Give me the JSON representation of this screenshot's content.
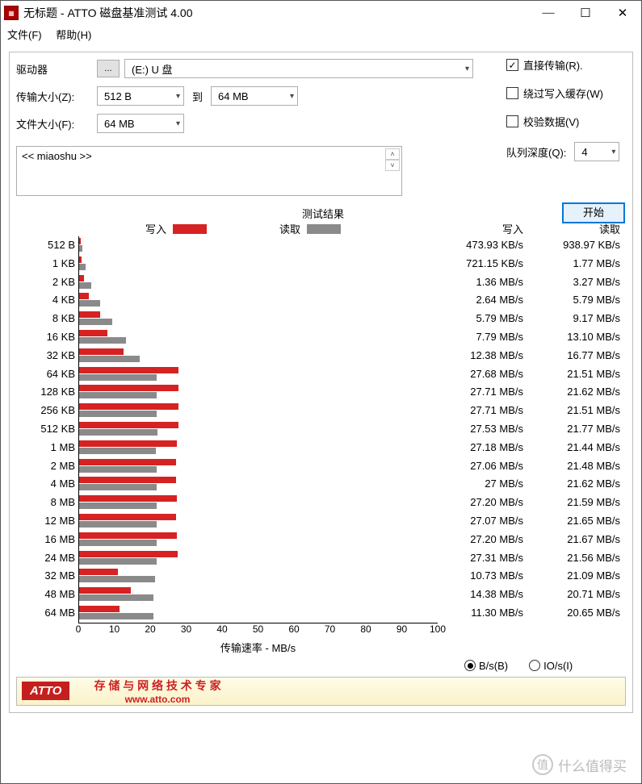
{
  "window": {
    "title": "无标题 - ATTO 磁盘基准测试 4.00"
  },
  "menu": {
    "file": "文件(F)",
    "help": "帮助(H)"
  },
  "labels": {
    "drive": "驱动器",
    "ellipsis": "...",
    "transfer_size": "传输大小(Z):",
    "to": "到",
    "file_size": "文件大小(F):"
  },
  "fields": {
    "drive": "(E:) U 盘",
    "ts_from": "512 B",
    "ts_to": "64 MB",
    "file_size": "64 MB",
    "desc": "<< miaoshu >>",
    "queue_depth": "4"
  },
  "checks": {
    "direct": "直接传输(R).",
    "direct_on": "✓",
    "bypass": "绕过写入缓存(W)",
    "verify": "校验数据(V)",
    "qd_label": "队列深度(Q):"
  },
  "buttons": {
    "start": "开始"
  },
  "results_title": "测试结果",
  "legend": {
    "write": "写入",
    "read": "读取"
  },
  "colors": {
    "write": "#d62222",
    "read": "#8a8a8a"
  },
  "x_axis_label": "传输速率 - MB/s",
  "radio": {
    "bs": "B/s(B)",
    "ios": "IO/s(I)"
  },
  "footer": {
    "brand": "ATTO",
    "slogan": "存 储 与 网 络 技 术 专 家",
    "url": "www.atto.com"
  },
  "watermark": {
    "icon": "值",
    "text": "什么值得买"
  },
  "chart_data": {
    "type": "bar",
    "title": "测试结果",
    "xlabel": "传输速率 - MB/s",
    "xlim": [
      0,
      100
    ],
    "x_ticks": [
      0,
      10,
      20,
      30,
      40,
      50,
      60,
      70,
      80,
      90,
      100
    ],
    "categories": [
      "512 B",
      "1 KB",
      "2 KB",
      "4 KB",
      "8 KB",
      "16 KB",
      "32 KB",
      "64 KB",
      "128 KB",
      "256 KB",
      "512 KB",
      "1 MB",
      "2 MB",
      "4 MB",
      "8 MB",
      "12 MB",
      "16 MB",
      "24 MB",
      "32 MB",
      "48 MB",
      "64 MB"
    ],
    "series": [
      {
        "name": "写入",
        "color": "#d62222",
        "values": [
          0.474,
          0.721,
          1.36,
          2.64,
          5.79,
          7.79,
          12.38,
          27.68,
          27.71,
          27.71,
          27.53,
          27.18,
          27.06,
          27.0,
          27.2,
          27.07,
          27.2,
          27.31,
          10.73,
          14.38,
          11.3
        ],
        "display": [
          "473.93 KB/s",
          "721.15 KB/s",
          "1.36 MB/s",
          "2.64 MB/s",
          "5.79 MB/s",
          "7.79 MB/s",
          "12.38 MB/s",
          "27.68 MB/s",
          "27.71 MB/s",
          "27.71 MB/s",
          "27.53 MB/s",
          "27.18 MB/s",
          "27.06 MB/s",
          "27 MB/s",
          "27.20 MB/s",
          "27.07 MB/s",
          "27.20 MB/s",
          "27.31 MB/s",
          "10.73 MB/s",
          "14.38 MB/s",
          "11.30 MB/s"
        ]
      },
      {
        "name": "读取",
        "color": "#8a8a8a",
        "values": [
          0.939,
          1.77,
          3.27,
          5.79,
          9.17,
          13.1,
          16.77,
          21.51,
          21.62,
          21.51,
          21.77,
          21.44,
          21.48,
          21.62,
          21.59,
          21.65,
          21.67,
          21.56,
          21.09,
          20.71,
          20.65
        ],
        "display": [
          "938.97 KB/s",
          "1.77 MB/s",
          "3.27 MB/s",
          "5.79 MB/s",
          "9.17 MB/s",
          "13.10 MB/s",
          "16.77 MB/s",
          "21.51 MB/s",
          "21.62 MB/s",
          "21.51 MB/s",
          "21.77 MB/s",
          "21.44 MB/s",
          "21.48 MB/s",
          "21.62 MB/s",
          "21.59 MB/s",
          "21.65 MB/s",
          "21.67 MB/s",
          "21.56 MB/s",
          "21.09 MB/s",
          "20.71 MB/s",
          "20.65 MB/s"
        ]
      }
    ]
  }
}
